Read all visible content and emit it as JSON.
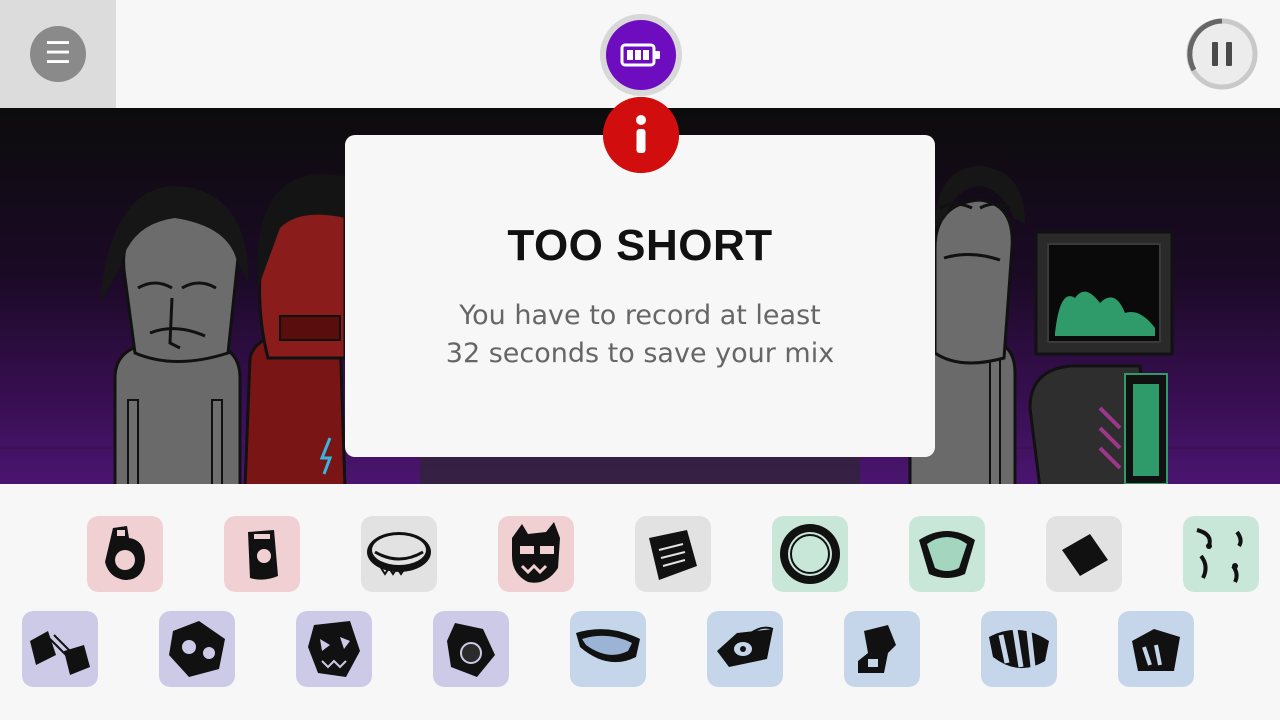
{
  "toolbar": {
    "menu_icon": "hamburger-icon",
    "menu_glyph": "☰",
    "record_icon": "battery-icon",
    "pause_icon": "pause-icon"
  },
  "dialog": {
    "title": "TOO SHORT",
    "message_line1": "You have to record at least",
    "message_line2": "32 seconds to save your mix",
    "badge_icon": "info-icon",
    "badge_color": "#d20d0d"
  },
  "colors": {
    "record_purple": "#6e0cc0",
    "beats_pink": "#f1d0d3",
    "effects_gray": "#e2e2e2",
    "melodies_green": "#c9e7d9",
    "vocals_lavender": "#cccae6",
    "voices_blue": "#c6d6ea"
  },
  "sounds": {
    "row1": [
      {
        "icon": "beat-sound-1-icon",
        "color": "#f1d0d3"
      },
      {
        "icon": "beat-sound-2-icon",
        "color": "#f1d0d3"
      },
      {
        "icon": "effect-sound-1-icon",
        "color": "#e2e2e2"
      },
      {
        "icon": "beat-sound-3-icon",
        "color": "#f1d0d3"
      },
      {
        "icon": "effect-sound-2-icon",
        "color": "#e2e2e2"
      },
      {
        "icon": "melody-sound-1-icon",
        "color": "#c9e7d9"
      },
      {
        "icon": "melody-sound-2-icon",
        "color": "#c9e7d9"
      },
      {
        "icon": "effect-sound-3-icon",
        "color": "#e2e2e2"
      },
      {
        "icon": "melody-sound-3-icon",
        "color": "#c9e7d9"
      }
    ],
    "row2": [
      {
        "icon": "vocal-sound-1-icon",
        "color": "#cccae6"
      },
      {
        "icon": "vocal-sound-2-icon",
        "color": "#cccae6"
      },
      {
        "icon": "vocal-sound-3-icon",
        "color": "#cccae6"
      },
      {
        "icon": "vocal-sound-4-icon",
        "color": "#cccae6"
      },
      {
        "icon": "voice-sound-1-icon",
        "color": "#c6d6ea"
      },
      {
        "icon": "voice-sound-2-icon",
        "color": "#c6d6ea"
      },
      {
        "icon": "voice-sound-3-icon",
        "color": "#c6d6ea"
      },
      {
        "icon": "voice-sound-4-icon",
        "color": "#c6d6ea"
      },
      {
        "icon": "voice-sound-5-icon",
        "color": "#c6d6ea"
      }
    ]
  }
}
